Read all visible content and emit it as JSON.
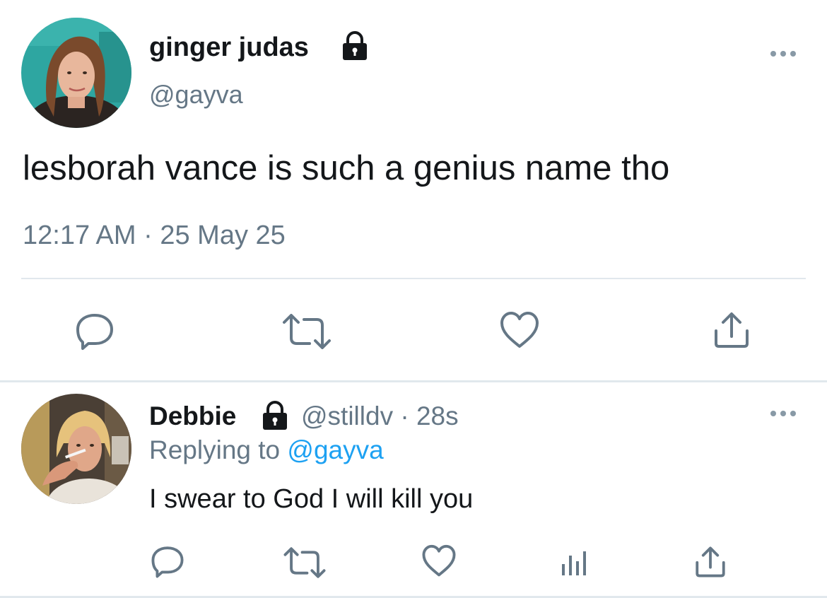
{
  "main_tweet": {
    "display_name": "ginger judas",
    "handle": "@gayva",
    "locked_icon": "lock-icon",
    "more_icon": "more-icon",
    "text": "lesborah vance is such a genius name tho",
    "time": "12:17 AM",
    "separator": "·",
    "date": "25 May 25",
    "actions": [
      "reply-icon",
      "retweet-icon",
      "like-icon",
      "share-icon"
    ]
  },
  "reply_tweet": {
    "display_name": "Debbie",
    "locked_icon": "lock-icon",
    "handle": "@stilldv",
    "separator": "·",
    "time_ago": "28s",
    "replying_label": "Replying to",
    "replying_handle": "@gayva",
    "text": "I swear to God I will kill you",
    "more_icon": "more-icon",
    "actions": [
      "reply-icon",
      "retweet-icon",
      "like-icon",
      "analytics-icon",
      "share-icon"
    ]
  },
  "colors": {
    "text": "#14171a",
    "secondary": "#657786",
    "link": "#1da1f2",
    "divider": "#e1e8ed",
    "icon": "#657786"
  }
}
